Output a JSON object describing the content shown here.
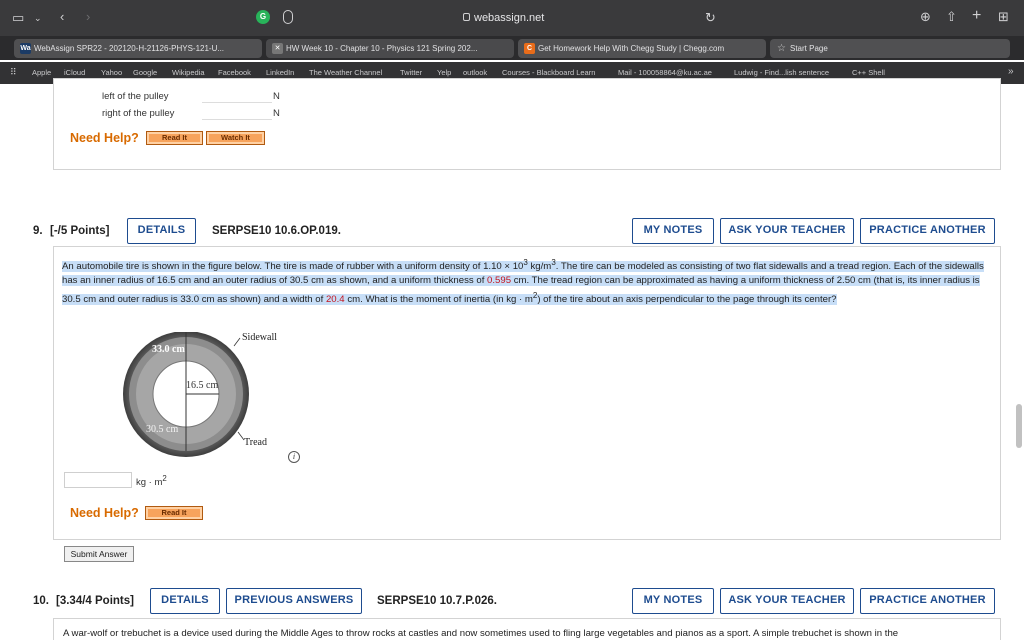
{
  "browser": {
    "url": "webassign.net",
    "tabs": [
      {
        "label": "WebAssign SPR22 - 202120-H-21126-PHYS-121-U...",
        "favicon": "Wa"
      },
      {
        "label": "HW Week 10 - Chapter 10 - Physics 121 Spring 202...",
        "favicon": "✕"
      },
      {
        "label": "Get Homework Help With Chegg Study | Chegg.com",
        "favicon": "C"
      },
      {
        "label": "Start Page",
        "favicon": "☆"
      }
    ],
    "bookmarks": [
      "Apple",
      "iCloud",
      "Yahoo",
      "Google",
      "Wikipedia",
      "Facebook",
      "LinkedIn",
      "The Weather Channel",
      "Twitter",
      "Yelp",
      "outlook",
      "Courses - Blackboard Learn",
      "Mail - 100058864@ku.ac.ae",
      "Ludwig - Find...lish sentence",
      "C++ Shell"
    ]
  },
  "prev_question": {
    "rows": [
      {
        "label": "left of the pulley",
        "unit": "N"
      },
      {
        "label": "right of the pulley",
        "unit": "N"
      }
    ],
    "need_help": "Need Help?",
    "read_it": "Read It",
    "watch_it": "Watch It"
  },
  "q9": {
    "number": "9.",
    "points": "[-/5 Points]",
    "details": "DETAILS",
    "code": "SERPSE10 10.6.OP.019.",
    "my_notes": "MY NOTES",
    "ask_teacher": "ASK YOUR TEACHER",
    "practice": "PRACTICE ANOTHER",
    "text": {
      "p1": "An automobile tire is shown in the figure below. The tire is made of rubber with a uniform density of 1.10 × 10",
      "p1_sup": "3",
      "p2": " kg/m",
      "p2_sup": "3",
      "p3": ". The tire can be modeled as consisting of two flat sidewalls and a tread region. Each of the sidewalls has an inner radius of 16.5 cm and an outer radius of 30.5 cm as shown, and a uniform thickness of ",
      "v_thick": "0.595",
      "p4": " cm. The tread region can be approximated as having a uniform thickness of 2.50 cm (that is, its inner radius is 30.5 cm and outer radius is 33.0 cm as shown) and a width of ",
      "v_width": "20.4",
      "p5": " cm. What is the moment of inertia (in kg · m",
      "p5_sup": "2",
      "p6": ") of the tire about an axis perpendicular to the page through its center?"
    },
    "figure": {
      "outer": "33.0 cm",
      "inner": "16.5 cm",
      "mid": "30.5 cm",
      "sidewall": "Sidewall",
      "tread": "Tread"
    },
    "answer_unit": "kg · m",
    "answer_unit_sup": "2",
    "need_help": "Need Help?",
    "read_it": "Read It",
    "submit": "Submit Answer"
  },
  "q10": {
    "number": "10.",
    "points": "[3.34/4 Points]",
    "details": "DETAILS",
    "previous": "PREVIOUS ANSWERS",
    "code": "SERPSE10 10.7.P.026.",
    "my_notes": "MY NOTES",
    "ask_teacher": "ASK YOUR TEACHER",
    "practice": "PRACTICE ANOTHER",
    "text": "A war-wolf or trebuchet is a device used during the Middle Ages to throw rocks at castles and now sometimes used to fling large vegetables and pianos as a sport. A simple trebuchet is shown in the"
  },
  "colors": {
    "accent": "#1e4c8f",
    "help": "#d86a00",
    "highlight": "#c7def7",
    "value": "#c4141e"
  }
}
